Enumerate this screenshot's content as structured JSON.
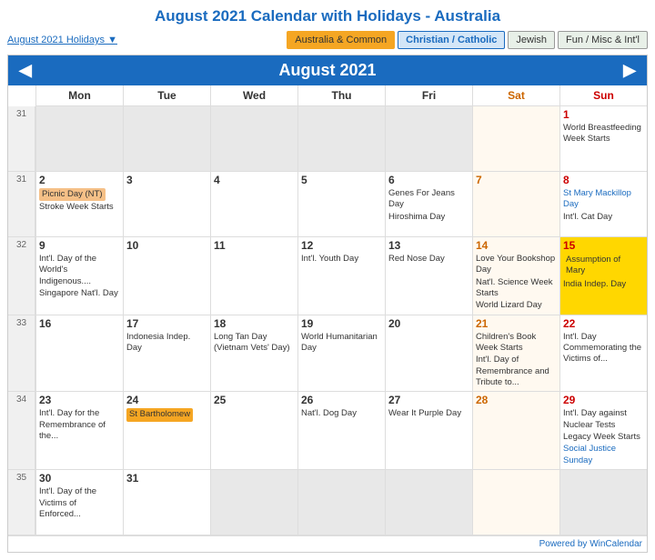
{
  "title": "August 2021 Calendar with Holidays - Australia",
  "holidaysLink": "August 2021 Holidays ▼",
  "tabs": [
    {
      "id": "australia",
      "label": "Australia & Common",
      "active": false
    },
    {
      "id": "christian",
      "label": "Christian / Catholic",
      "active": true
    },
    {
      "id": "jewish",
      "label": "Jewish",
      "active": false
    },
    {
      "id": "fun",
      "label": "Fun / Misc & Int'l",
      "active": false
    }
  ],
  "monthTitle": "August 2021",
  "dayHeaders": [
    "Mon",
    "Tue",
    "Wed",
    "Thu",
    "Fri",
    "Sat",
    "Sun"
  ],
  "weeks": [
    {
      "weekNum": "31",
      "days": [
        {
          "date": "",
          "otherMonth": true,
          "events": []
        },
        {
          "date": "",
          "otherMonth": true,
          "events": []
        },
        {
          "date": "",
          "otherMonth": true,
          "events": []
        },
        {
          "date": "",
          "otherMonth": true,
          "events": []
        },
        {
          "date": "",
          "otherMonth": true,
          "events": []
        },
        {
          "date": "",
          "otherMonth": true,
          "sat": true,
          "events": []
        },
        {
          "date": "1",
          "sun": true,
          "events": [
            {
              "text": "World Breastfeeding Week Starts",
              "type": "fun"
            }
          ]
        }
      ]
    },
    {
      "weekNum": "31",
      "days": [
        {
          "date": "2",
          "events": [
            {
              "text": "Picnic Day (NT)",
              "type": "holiday-pill"
            },
            {
              "text": "Stroke Week Starts",
              "type": "fun"
            }
          ]
        },
        {
          "date": "3",
          "events": []
        },
        {
          "date": "4",
          "events": []
        },
        {
          "date": "5",
          "events": []
        },
        {
          "date": "6",
          "events": [
            {
              "text": "Genes For Jeans Day",
              "type": "fun"
            },
            {
              "text": "Hiroshima Day",
              "type": "fun"
            }
          ]
        },
        {
          "date": "7",
          "sat": true,
          "events": []
        },
        {
          "date": "8",
          "sun": true,
          "events": [
            {
              "text": "St Mary Mackillop Day",
              "type": "christian"
            },
            {
              "text": "Int'l. Cat Day",
              "type": "fun"
            }
          ]
        }
      ]
    },
    {
      "weekNum": "32",
      "days": [
        {
          "date": "9",
          "events": [
            {
              "text": "Int'l. Day of the World's Indigenous....",
              "type": "fun"
            },
            {
              "text": "Singapore Nat'l. Day",
              "type": "fun"
            }
          ]
        },
        {
          "date": "10",
          "events": []
        },
        {
          "date": "11",
          "events": []
        },
        {
          "date": "12",
          "events": [
            {
              "text": "Int'l. Youth Day",
              "type": "fun"
            }
          ]
        },
        {
          "date": "13",
          "events": [
            {
              "text": "Red Nose Day",
              "type": "fun"
            }
          ]
        },
        {
          "date": "14",
          "sat": true,
          "events": [
            {
              "text": "Love Your Bookshop Day",
              "type": "fun"
            },
            {
              "text": "Nat'l. Science Week Starts",
              "type": "fun"
            },
            {
              "text": "World Lizard Day",
              "type": "fun"
            }
          ]
        },
        {
          "date": "15",
          "sun": true,
          "assumption": true,
          "events": [
            {
              "text": "Assumption of Mary",
              "type": "christian-pill"
            },
            {
              "text": "India Indep. Day",
              "type": "fun"
            }
          ]
        }
      ]
    },
    {
      "weekNum": "33",
      "days": [
        {
          "date": "16",
          "events": []
        },
        {
          "date": "17",
          "events": [
            {
              "text": "Indonesia Indep. Day",
              "type": "fun"
            }
          ]
        },
        {
          "date": "18",
          "events": [
            {
              "text": "Long Tan Day (Vietnam Vets' Day)",
              "type": "fun"
            }
          ]
        },
        {
          "date": "19",
          "events": [
            {
              "text": "World Humanitarian Day",
              "type": "fun"
            }
          ]
        },
        {
          "date": "20",
          "events": []
        },
        {
          "date": "21",
          "sat": true,
          "events": [
            {
              "text": "Children's Book Week Starts",
              "type": "fun"
            },
            {
              "text": "Int'l. Day of Remembrance and Tribute to...",
              "type": "fun"
            }
          ]
        },
        {
          "date": "22",
          "sun": true,
          "events": [
            {
              "text": "Int'l. Day Commemorating the Victims of...",
              "type": "fun"
            }
          ]
        }
      ]
    },
    {
      "weekNum": "34",
      "days": [
        {
          "date": "23",
          "events": [
            {
              "text": "Int'l. Day for the Remembrance of the...",
              "type": "fun"
            }
          ]
        },
        {
          "date": "24",
          "events": [
            {
              "text": "St Bartholomew",
              "type": "orange-pill"
            }
          ]
        },
        {
          "date": "25",
          "events": []
        },
        {
          "date": "26",
          "events": [
            {
              "text": "Nat'l. Dog Day",
              "type": "fun"
            }
          ]
        },
        {
          "date": "27",
          "events": [
            {
              "text": "Wear It Purple Day",
              "type": "fun"
            }
          ]
        },
        {
          "date": "28",
          "sat": true,
          "events": []
        },
        {
          "date": "29",
          "sun": true,
          "events": [
            {
              "text": "Int'l. Day against Nuclear Tests",
              "type": "fun"
            },
            {
              "text": "Legacy Week Starts",
              "type": "fun"
            },
            {
              "text": "Social Justice Sunday",
              "type": "christian"
            }
          ]
        }
      ]
    },
    {
      "weekNum": "35",
      "days": [
        {
          "date": "30",
          "events": [
            {
              "text": "Int'l. Day of the Victims of Enforced...",
              "type": "fun"
            }
          ]
        },
        {
          "date": "31",
          "events": []
        },
        {
          "date": "",
          "otherMonth": true,
          "events": []
        },
        {
          "date": "",
          "otherMonth": true,
          "events": []
        },
        {
          "date": "",
          "otherMonth": true,
          "events": []
        },
        {
          "date": "",
          "otherMonth": true,
          "sat": true,
          "events": []
        },
        {
          "date": "",
          "otherMonth": true,
          "sun": true,
          "events": []
        }
      ]
    }
  ],
  "footer": "Powered by WinCalendar"
}
